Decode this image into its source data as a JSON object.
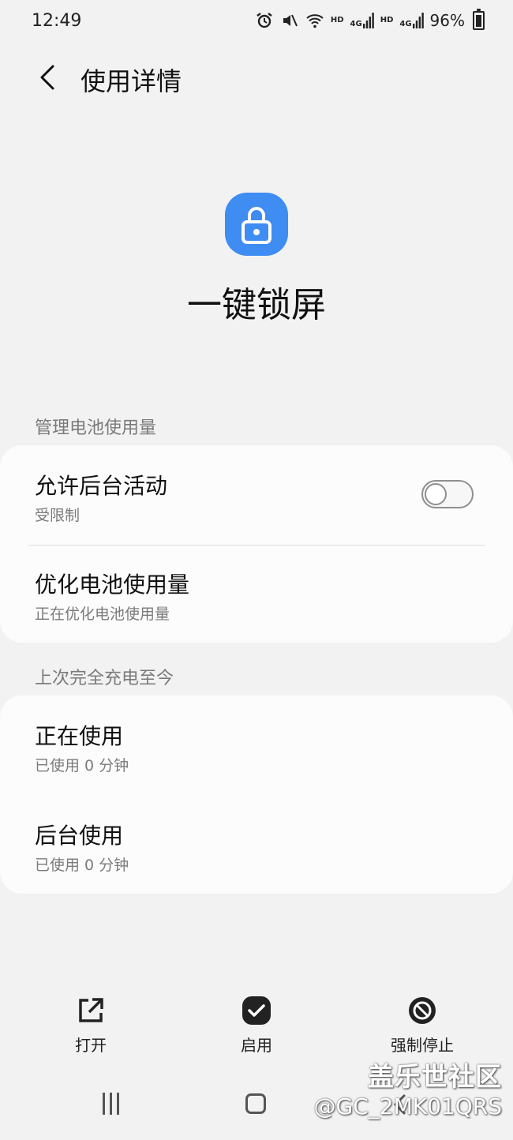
{
  "status_bar": {
    "time": "12:49",
    "hd1": "HD",
    "net1": "4G",
    "hd2": "HD",
    "net2": "4G",
    "battery": "96%"
  },
  "header": {
    "title": "使用详情"
  },
  "app": {
    "name": "一键锁屏",
    "icon": "lock-icon",
    "icon_color": "#3f8cf2"
  },
  "sections": {
    "manage_battery": {
      "label": "管理电池使用量",
      "items": [
        {
          "title": "允许后台活动",
          "subtitle": "受限制",
          "toggle": false
        },
        {
          "title": "优化电池使用量",
          "subtitle": "正在优化电池使用量"
        }
      ]
    },
    "since_full_charge": {
      "label": "上次完全充电至今",
      "items": [
        {
          "title": "正在使用",
          "subtitle": "已使用 0 分钟"
        },
        {
          "title": "后台使用",
          "subtitle": "已使用 0 分钟"
        }
      ]
    }
  },
  "actions": {
    "open": "打开",
    "enable": "启用",
    "force_stop": "强制停止"
  },
  "watermark": {
    "line1": "盖乐世社区",
    "line2": "@GC_2MK01QRS"
  }
}
